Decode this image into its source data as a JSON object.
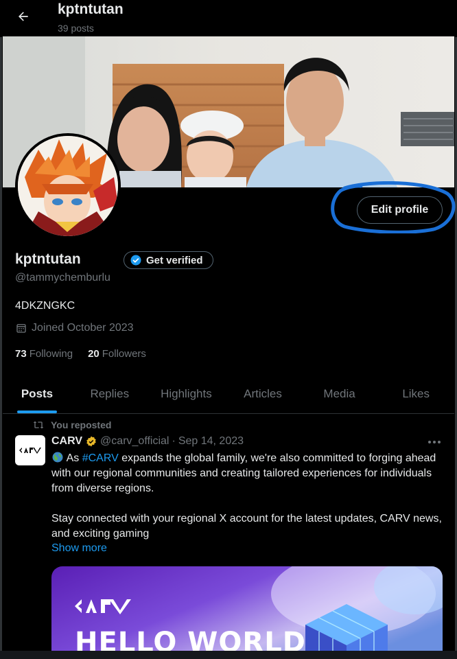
{
  "header": {
    "back_label": "Back",
    "name": "kptntutan",
    "posts_count": "39 posts"
  },
  "profile": {
    "edit_button": "Edit profile",
    "display_name": "kptntutan",
    "get_verified": "Get verified",
    "handle": "@tammychemburlu",
    "bio": "4DKZNGKC",
    "joined": "Joined October 2023",
    "following_count": "73",
    "following_label": "Following",
    "followers_count": "20",
    "followers_label": "Followers"
  },
  "tabs": [
    {
      "label": "Posts",
      "active": true
    },
    {
      "label": "Replies"
    },
    {
      "label": "Highlights"
    },
    {
      "label": "Articles"
    },
    {
      "label": "Media"
    },
    {
      "label": "Likes"
    }
  ],
  "tweet": {
    "repost_label": "You reposted",
    "author_name": "CARV",
    "author_handle": "@carv_official",
    "separator": "·",
    "date": "Sep 14, 2023",
    "text_line1_pre": "As ",
    "hashtag": "#CARV",
    "text_line1_post": " expands the global family, we're also committed to forging ahead with our regional communities and creating tailored experiences for individuals from diverse regions.",
    "text_para2": "Stay connected with your regional X account for the latest updates, CARV news, and exciting gaming",
    "show_more": "Show more",
    "media_logo": "CARV",
    "media_headline": "HELLO WORLD"
  },
  "colors": {
    "accent": "#1d9bf0",
    "background": "#000000",
    "muted": "#71767b",
    "annotation_ring": "#1a6fd6"
  }
}
